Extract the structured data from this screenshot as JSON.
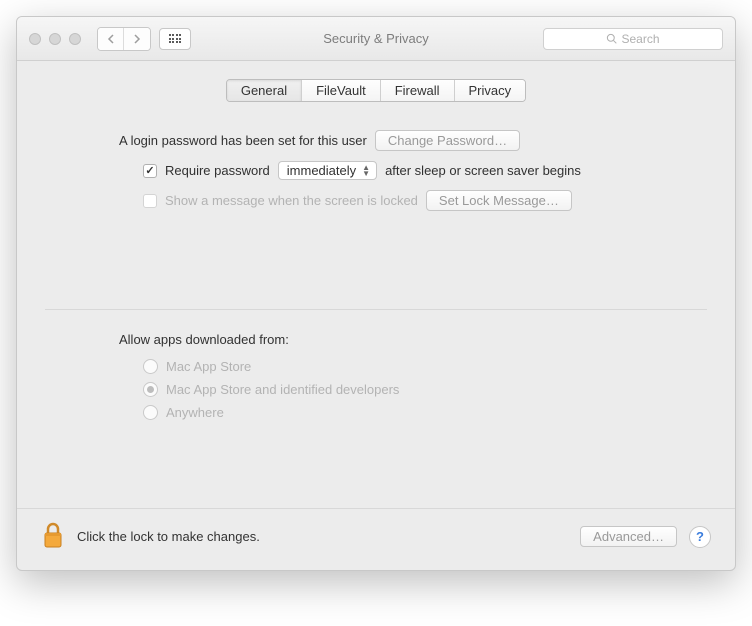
{
  "window": {
    "title": "Security & Privacy",
    "search_placeholder": "Search"
  },
  "tabs": {
    "general": "General",
    "filevault": "FileVault",
    "firewall": "Firewall",
    "privacy": "Privacy"
  },
  "general": {
    "login_password_set": "A login password has been set for this user",
    "change_password_btn": "Change Password…",
    "require_password_label": "Require password",
    "require_password_delay": "immediately",
    "require_password_suffix": "after sleep or screen saver begins",
    "show_message_label": "Show a message when the screen is locked",
    "set_lock_message_btn": "Set Lock Message…",
    "allow_apps_heading": "Allow apps downloaded from:",
    "options": {
      "mas": "Mac App Store",
      "mas_identified": "Mac App Store and identified developers",
      "anywhere": "Anywhere"
    }
  },
  "footer": {
    "lock_text": "Click the lock to make changes.",
    "advanced_btn": "Advanced…"
  }
}
